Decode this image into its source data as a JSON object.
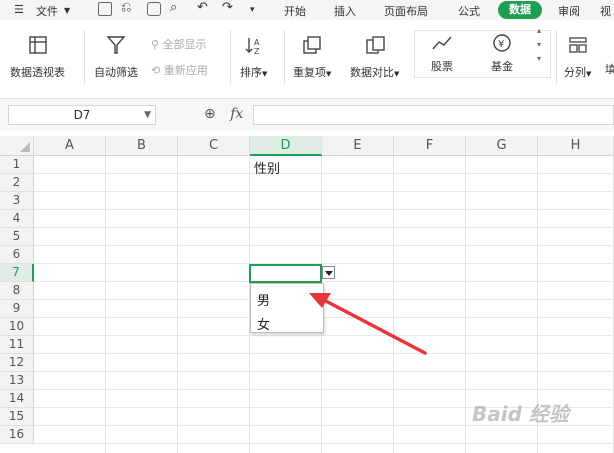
{
  "menubar": {
    "file_label": "文件",
    "tabs": [
      "开始",
      "插入",
      "页面布局",
      "公式",
      "数据",
      "审阅",
      "视"
    ],
    "active_tab": "数据"
  },
  "ribbon": {
    "pivot_table": "数据透视表",
    "auto_filter": "自动筛选",
    "show_all": "全部显示",
    "reapply": "重新应用",
    "sort": "排序",
    "duplicates": "重复项",
    "compare": "数据对比",
    "stocks": "股票",
    "funds": "基金",
    "split": "分列",
    "more": "填"
  },
  "formula_bar": {
    "name_box": "D7",
    "fx_label": "fx"
  },
  "grid": {
    "columns": [
      "A",
      "B",
      "C",
      "D",
      "E",
      "F",
      "G",
      "H"
    ],
    "selected_column": "D",
    "rows": [
      "1",
      "2",
      "3",
      "4",
      "5",
      "6",
      "7",
      "8",
      "9",
      "10",
      "11",
      "12",
      "13",
      "14",
      "15",
      "16"
    ],
    "selected_row": "7",
    "cells": {
      "D1": "性别"
    }
  },
  "dropdown": {
    "options": [
      "男",
      "女"
    ]
  },
  "accent_color": "#1f9e53",
  "annotation_color": "#e8353a",
  "watermark": "Baid 经验"
}
